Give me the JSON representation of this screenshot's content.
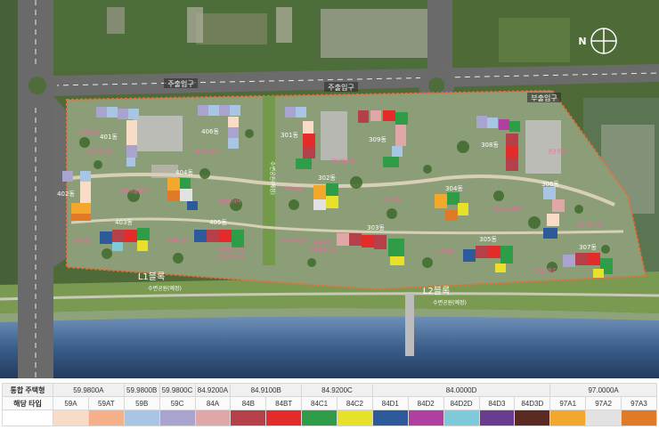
{
  "compass": {
    "label": "N"
  },
  "roads": {
    "main_entrance_1": "주출입구",
    "main_entrance_2": "주출입구",
    "sub_entrance": "부출입구"
  },
  "blocks": {
    "l1": "L1블록",
    "l2": "L2블록"
  },
  "parks": {
    "waterfront_1": "수변공원(예정)",
    "waterfront_2": "수변공원(예정)",
    "greenway": "수변공원(예정)"
  },
  "buildings": [
    {
      "id": "b401",
      "label": "401동"
    },
    {
      "id": "b402",
      "label": "402동"
    },
    {
      "id": "b403",
      "label": "403동"
    },
    {
      "id": "b404",
      "label": "404동"
    },
    {
      "id": "b405",
      "label": "405동"
    },
    {
      "id": "b406",
      "label": "406동"
    },
    {
      "id": "b301",
      "label": "301동"
    },
    {
      "id": "b302",
      "label": "302동"
    },
    {
      "id": "b303",
      "label": "303동"
    },
    {
      "id": "b304",
      "label": "304동"
    },
    {
      "id": "b305",
      "label": "305동"
    },
    {
      "id": "b306",
      "label": "306동"
    },
    {
      "id": "b307",
      "label": "307동"
    },
    {
      "id": "b308",
      "label": "308동"
    },
    {
      "id": "b309",
      "label": "309동"
    }
  ],
  "facilities": [
    {
      "id": "f1",
      "label": "어울림광장"
    },
    {
      "id": "f2",
      "label": "소통마당광장"
    },
    {
      "id": "f3",
      "label": "문화어울광장"
    },
    {
      "id": "f4",
      "label": "유아놀이터"
    },
    {
      "id": "f5",
      "label": "어린이놀이터"
    },
    {
      "id": "f6",
      "label": "주민운동시설"
    },
    {
      "id": "f7",
      "label": "주민공동시설"
    },
    {
      "id": "f8",
      "label": "숲속정원"
    },
    {
      "id": "f9",
      "label": "다목적광장"
    },
    {
      "id": "f10",
      "label": "휴게정원"
    },
    {
      "id": "f11",
      "label": "커뮤니티광장"
    },
    {
      "id": "f12",
      "label": "텃밭가든"
    },
    {
      "id": "f13",
      "label": "주민공동시설"
    },
    {
      "id": "f14",
      "label": "만남의광장"
    },
    {
      "id": "f15",
      "label": "휴게정원"
    },
    {
      "id": "f16",
      "label": "행복나눔광장"
    },
    {
      "id": "f17",
      "label": "산책정원"
    },
    {
      "id": "f18",
      "label": "경관정원"
    },
    {
      "id": "f19",
      "label": "어린이놀이터"
    },
    {
      "id": "f20",
      "label": "수변산책로"
    }
  ],
  "legend": {
    "row1_head": "통합 주택형",
    "row2_head": "해당 타입",
    "groups": [
      {
        "label": "59.9800A",
        "span": 2
      },
      {
        "label": "59.9800B",
        "span": 1
      },
      {
        "label": "59.9800C",
        "span": 1
      },
      {
        "label": "84.9200A",
        "span": 1
      },
      {
        "label": "84.9100B",
        "span": 2
      },
      {
        "label": "84.9200C",
        "span": 2
      },
      {
        "label": "84.0000D",
        "span": 5
      },
      {
        "label": "97.0000A",
        "span": 3
      }
    ],
    "types": [
      {
        "label": "59A",
        "color": "#f8dcc8"
      },
      {
        "label": "59AT",
        "color": "#f5b08a"
      },
      {
        "label": "59B",
        "color": "#a8c6e3"
      },
      {
        "label": "59C",
        "color": "#a9a3d0"
      },
      {
        "label": "84A",
        "color": "#e0a7a7"
      },
      {
        "label": "84B",
        "color": "#b5404a"
      },
      {
        "label": "84BT",
        "color": "#e32b2b"
      },
      {
        "label": "84C1",
        "color": "#2f9d48"
      },
      {
        "label": "84C2",
        "color": "#e8e12a"
      },
      {
        "label": "84D1",
        "color": "#2c5a9a"
      },
      {
        "label": "84D2",
        "color": "#b13ea1"
      },
      {
        "label": "84D2D",
        "color": "#7ec9da"
      },
      {
        "label": "84D3",
        "color": "#6a3c8f"
      },
      {
        "label": "84D3D",
        "color": "#5a2a22"
      },
      {
        "label": "97A1",
        "color": "#f2a82c"
      },
      {
        "label": "97A2",
        "color": "#e2e2e2"
      },
      {
        "label": "97A3",
        "color": "#e07a26"
      }
    ]
  }
}
